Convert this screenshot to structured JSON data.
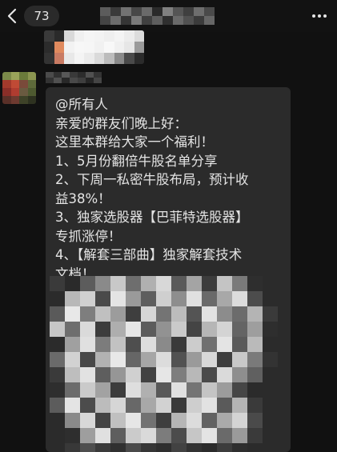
{
  "header": {
    "unread_count": "73"
  },
  "message": {
    "lines": [
      "@所有人",
      "亲爱的群友们晚上好：",
      "这里本群给大家一个福利！",
      "1、5月份翻倍牛股名单分享",
      "2、下周一私密牛股布局，预计收",
      "益38%！",
      "3、独家选股器【巴菲特选股器】",
      "专抓涨停！",
      "4、【解套三部曲】独家解套技术",
      "文档！"
    ]
  },
  "colors": {
    "background": "#111111",
    "bubble": "#2b2b2b",
    "text": "#e4e4e4"
  }
}
